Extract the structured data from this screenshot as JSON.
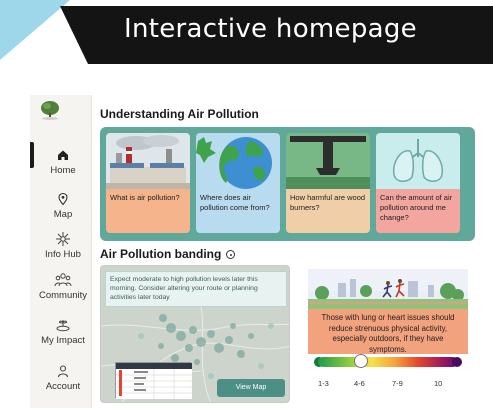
{
  "header": {
    "title": "Interactive homepage"
  },
  "sidebar": {
    "items": [
      {
        "label": "Home",
        "icon": "home-icon"
      },
      {
        "label": "Map",
        "icon": "map-pin-icon"
      },
      {
        "label": "Info Hub",
        "icon": "info-hub-icon"
      },
      {
        "label": "Community",
        "icon": "community-icon"
      },
      {
        "label": "My Impact",
        "icon": "impact-icon"
      },
      {
        "label": "Account",
        "icon": "account-icon"
      }
    ],
    "active": "Home"
  },
  "understanding": {
    "title": "Understanding Air Pollution",
    "cards": [
      {
        "caption": "What is air pollution?",
        "color": "#f5b48c"
      },
      {
        "caption": "Where does air pollution come from?",
        "color": "#b8dbf0"
      },
      {
        "caption": "How harmful are wood burners?",
        "color": "#f0cfa8"
      },
      {
        "caption": "Can the amount of air pollution around me change?",
        "color": "#f3a6a0"
      }
    ]
  },
  "banding": {
    "title": "Air Pollution banding",
    "map_note": "Expect moderate to high pollution levels later this morning. Consider altering your route or planning activities later today",
    "view_map_label": "View Map",
    "advice": "Those with lung or heart issues should reduce strenuous physical activity, especially outdoors, if they have symptoms.",
    "scale_labels": [
      "1-3",
      "4-6",
      "7-9",
      "10"
    ],
    "current_band": "4-6"
  },
  "colors": {
    "teal": "#5fa89a",
    "advice": "#f2a27d",
    "header": "#141414",
    "accent_blue": "#9ed6ea"
  }
}
